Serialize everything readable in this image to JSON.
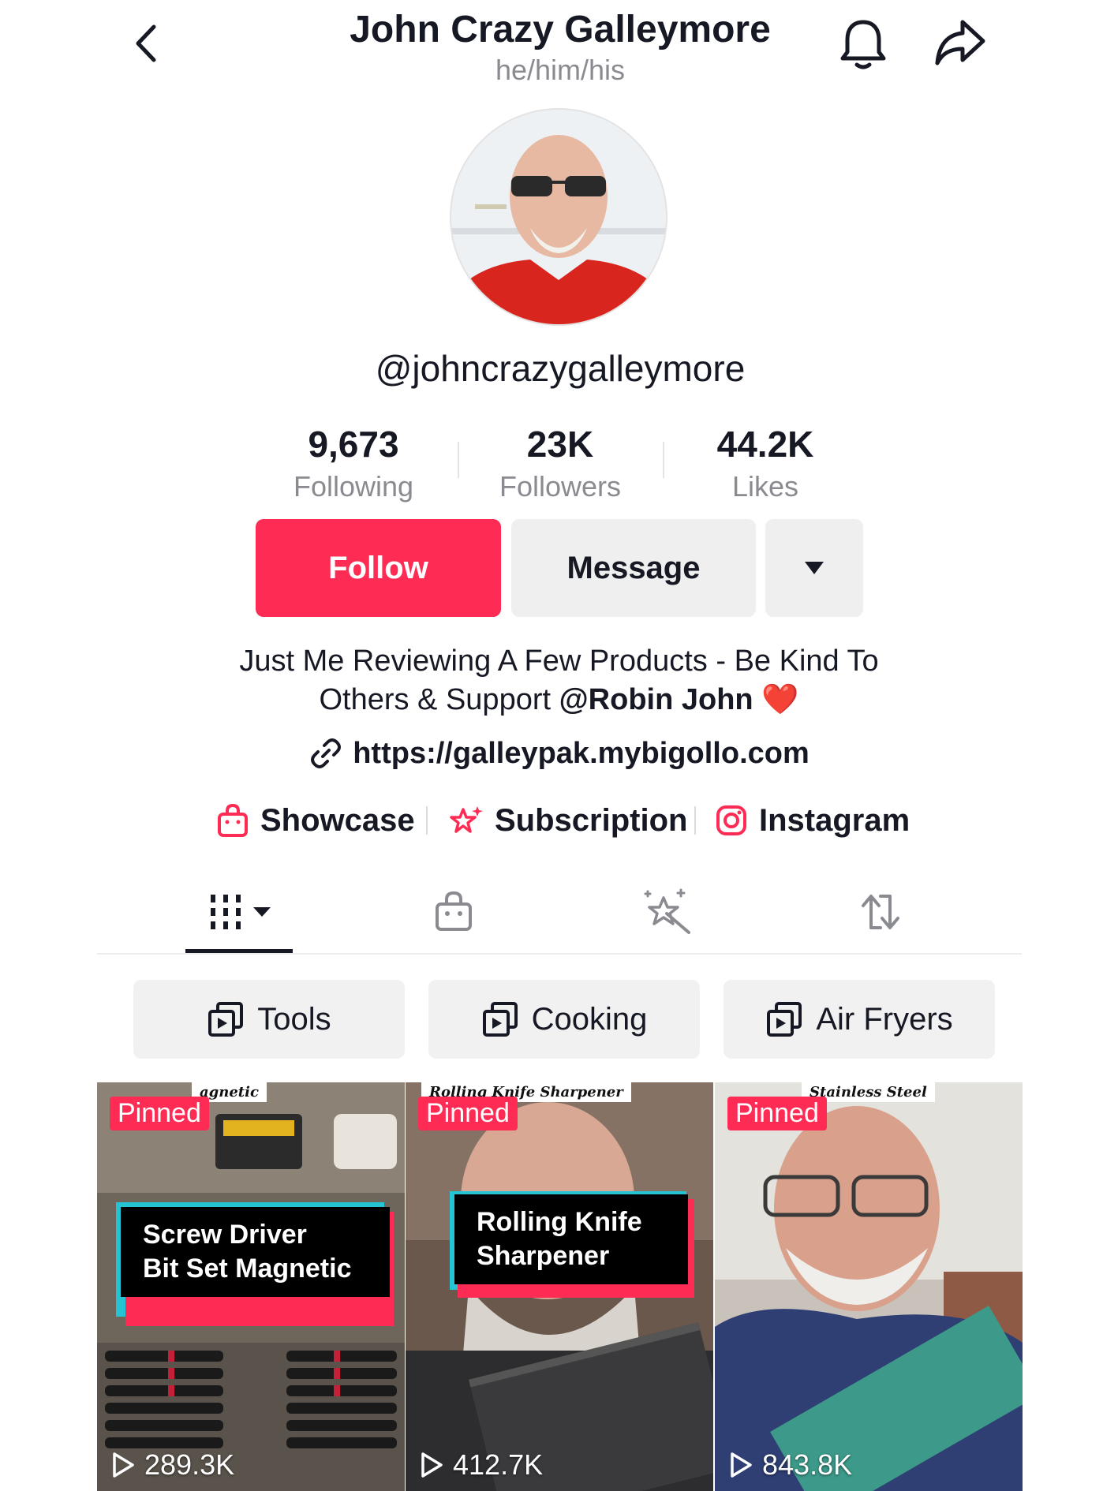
{
  "header": {
    "title": "John Crazy Galleymore",
    "pronouns": "he/him/his"
  },
  "profile": {
    "username": "@johncrazygalleymore",
    "stats": [
      {
        "value": "9,673",
        "label": "Following"
      },
      {
        "value": "23K",
        "label": "Followers"
      },
      {
        "value": "44.2K",
        "label": "Likes"
      }
    ],
    "follow_label": "Follow",
    "message_label": "Message",
    "bio_line1": "Just Me Reviewing A Few Products - Be Kind To",
    "bio_line2_prefix": "Others & Support ",
    "bio_mention": "@Robin John",
    "bio_emoji": "❤️",
    "link": "https://galleypak.mybigollo.com"
  },
  "links": [
    {
      "label": "Showcase",
      "icon": "shopping-bag-icon"
    },
    {
      "label": "Subscription",
      "icon": "star-sparkle-icon"
    },
    {
      "label": "Instagram",
      "icon": "instagram-icon"
    }
  ],
  "tabs": [
    {
      "icon": "grid-videos-icon",
      "active": true
    },
    {
      "icon": "shopping-bag-icon",
      "active": false
    },
    {
      "icon": "magic-sparkle-icon",
      "active": false
    },
    {
      "icon": "repost-icon",
      "active": false
    }
  ],
  "playlists": [
    {
      "label": "Tools"
    },
    {
      "label": "Cooking"
    },
    {
      "label": "Air Fryers"
    }
  ],
  "videos": [
    {
      "pinned": "Pinned",
      "caption_line1": "Screw Driver",
      "caption_line2": "Bit Set Magnetic",
      "views": "289.3K",
      "top_text": "agnetic"
    },
    {
      "pinned": "Pinned",
      "caption_line1": "Rolling Knife",
      "caption_line2": "Sharpener",
      "views": "412.7K",
      "top_text": "Rolling Knife Sharpener"
    },
    {
      "pinned": "Pinned",
      "caption_line1": "",
      "caption_line2": "",
      "views": "843.8K",
      "top_text": "Stainless Steel"
    }
  ],
  "colors": {
    "accent": "#fe2c55",
    "text": "#161823",
    "muted": "#8a8b91",
    "button_bg": "#efeff0"
  }
}
